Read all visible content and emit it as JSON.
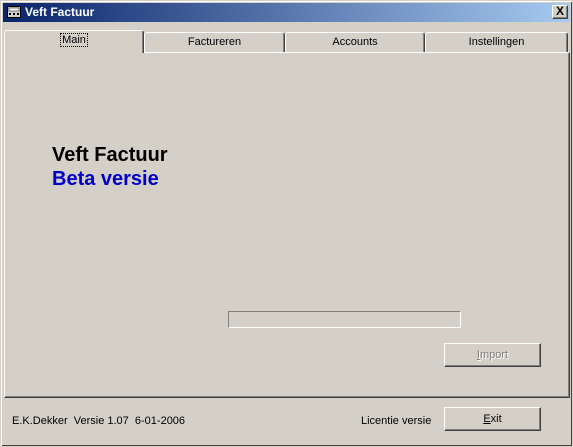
{
  "window": {
    "title": "Veft Factuur",
    "close_glyph": "X",
    "app_icon": "calculator-icon"
  },
  "tabs": [
    {
      "label": "Main",
      "active": true
    },
    {
      "label": "Factureren",
      "active": false
    },
    {
      "label": "Accounts",
      "active": false
    },
    {
      "label": "Instellingen",
      "active": false
    }
  ],
  "main": {
    "app_name": "Veft Factuur",
    "subtitle": "Beta versie",
    "subtitle_color": "#0000c8",
    "progress": 0,
    "import_button": {
      "prefix": "",
      "underlined": "I",
      "rest": "mport",
      "enabled": false
    }
  },
  "footer": {
    "author_version": "E.K.Dekker  Versie 1.07  6-01-2006",
    "license": "Licentie versie",
    "exit_button": {
      "underlined": "E",
      "rest": "xit"
    }
  },
  "colors": {
    "titlebar_start": "#0a246a",
    "titlebar_end": "#a6caf0",
    "face": "#d4d0c8"
  }
}
